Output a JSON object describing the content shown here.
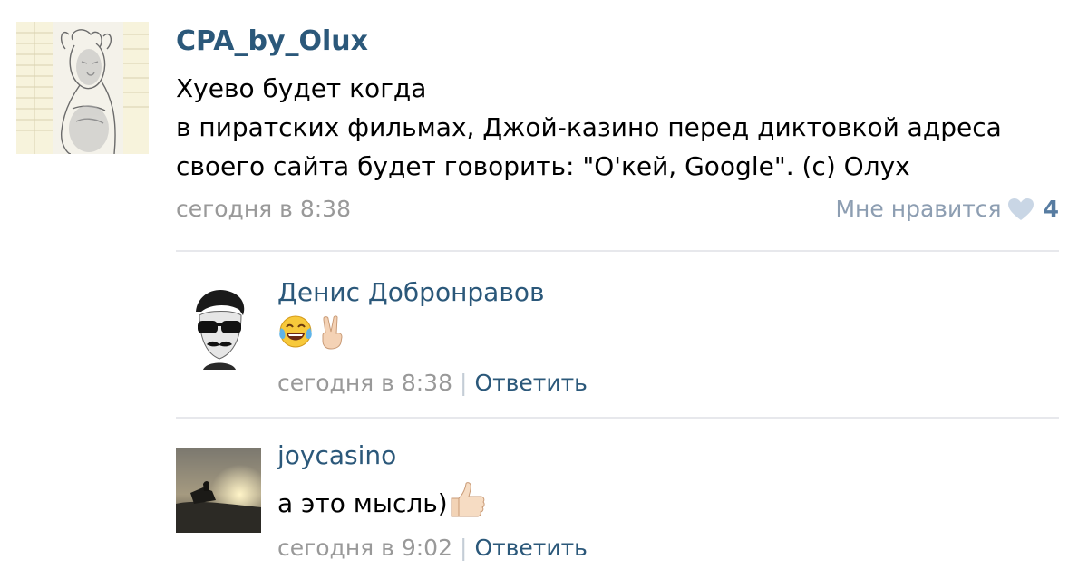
{
  "post": {
    "author": "CPA_by_Olux",
    "text_lines": [
      "Хуево будет когда",
      "в пиратских фильмах, Джой-казино перед диктовкой адреса",
      "своего сайта будет говорить: \"О'кей, Google\". (с) Олух"
    ],
    "date": "сегодня в 8:38",
    "like_label": "Мне нравится",
    "like_count": "4"
  },
  "comments": [
    {
      "author": "Денис Добронравов",
      "text": "",
      "emojis": [
        "tears-of-joy-emoji",
        "victory-hand-emoji"
      ],
      "date": "сегодня в 8:38",
      "separator": "|",
      "reply_label": "Ответить"
    },
    {
      "author": "joycasino",
      "text": "а это мысль)",
      "emojis": [
        "thumbs-up-emoji"
      ],
      "date": "сегодня в 9:02",
      "separator": "|",
      "reply_label": "Ответить"
    }
  ],
  "colors": {
    "link": "#2b587a",
    "muted": "#999999",
    "like": "#8d9eb2",
    "divider": "#e7e8ec"
  }
}
